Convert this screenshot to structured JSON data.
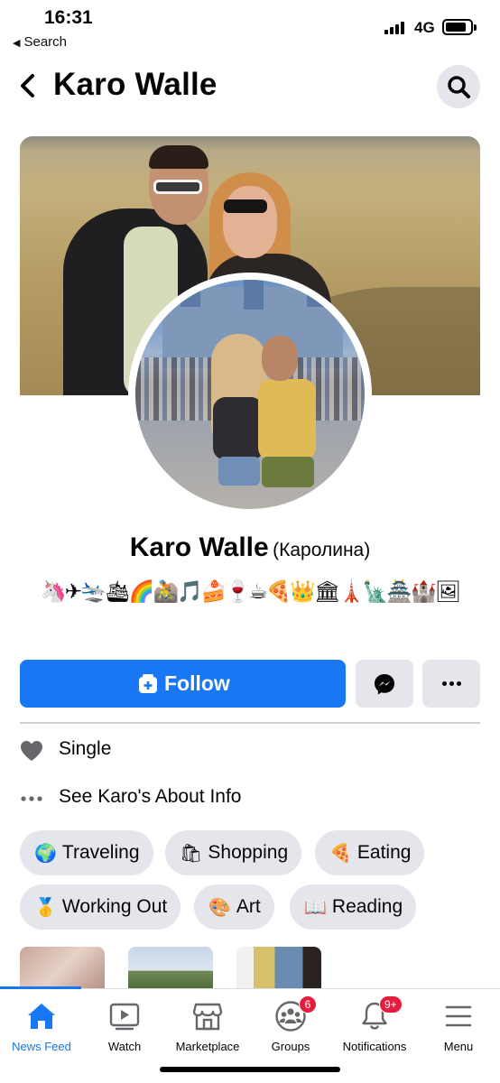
{
  "status_bar": {
    "time": "16:31",
    "back_app_label": "Search",
    "network": "4G"
  },
  "header": {
    "title": "Karo Walle",
    "back_icon": "chevron-left-icon",
    "search_icon": "search-icon"
  },
  "profile": {
    "name": "Karo Walle",
    "alternate_name": "(Каролина)",
    "bio": "🦄✈🛬🛳🌈🚵🎵🍰🍷☕🍕👑🏛🗼🗽🏯🏰🖼"
  },
  "actions": {
    "follow_label": "Follow",
    "message_icon": "messenger-icon",
    "more_icon": "more-icon"
  },
  "intro": {
    "relationship": "Single",
    "about_link": "See Karo's About Info"
  },
  "interests": [
    {
      "emoji": "🌍",
      "label": "Traveling"
    },
    {
      "emoji": "🛍",
      "label": "Shopping"
    },
    {
      "emoji": "🍕",
      "label": "Eating"
    },
    {
      "emoji": "🥇",
      "label": "Working Out"
    },
    {
      "emoji": "🎨",
      "label": "Art"
    },
    {
      "emoji": "📖",
      "label": "Reading"
    }
  ],
  "tabbar": {
    "active": "news-feed",
    "tabs": [
      {
        "label": "News Feed",
        "icon": "home-icon"
      },
      {
        "label": "Watch",
        "icon": "video-icon"
      },
      {
        "label": "Marketplace",
        "icon": "shop-icon"
      },
      {
        "label": "Groups",
        "icon": "groups-icon",
        "badge": "6"
      },
      {
        "label": "Notifications",
        "icon": "bell-icon",
        "badge": "9+"
      },
      {
        "label": "Menu",
        "icon": "menu-icon"
      }
    ]
  },
  "colors": {
    "accent": "#1877f2",
    "button_gray": "#e4e6eb",
    "badge_red": "#e41e3f"
  }
}
